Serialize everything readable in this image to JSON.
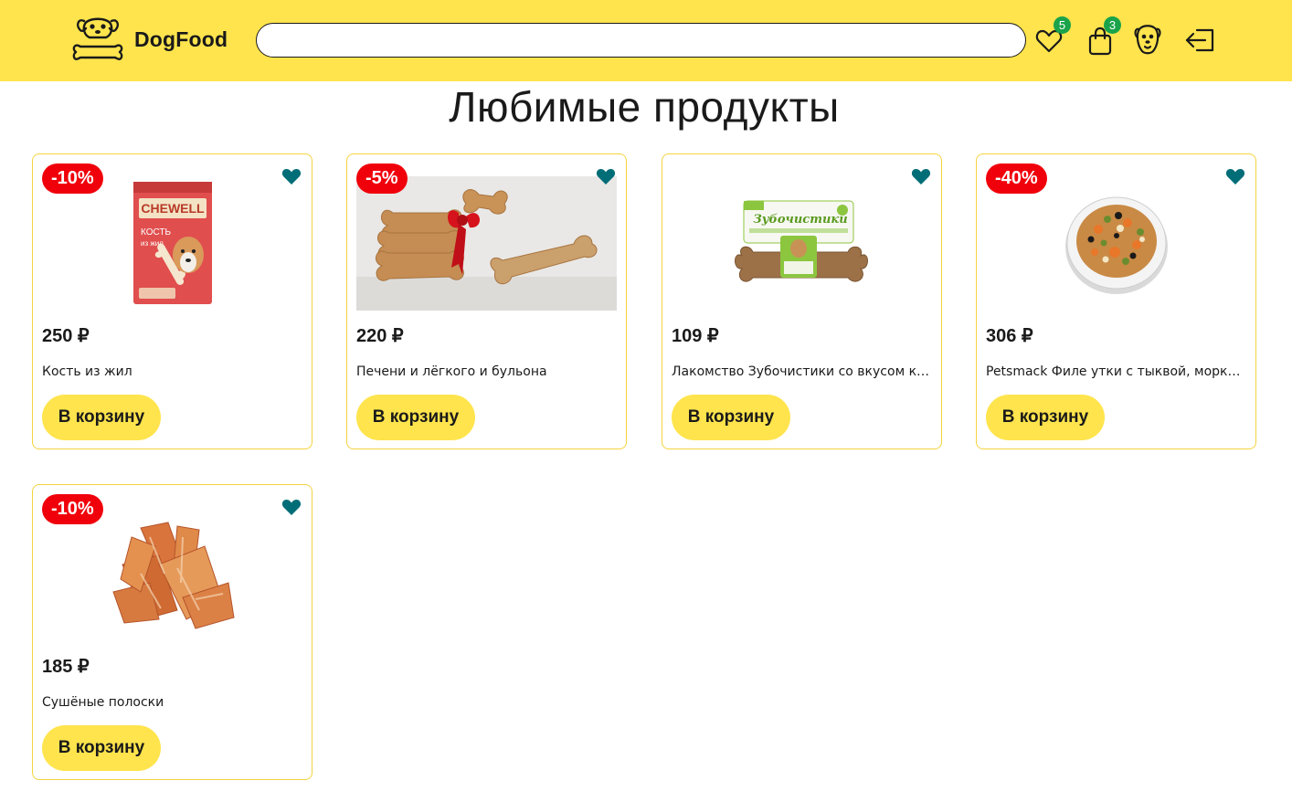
{
  "header": {
    "brand": "DogFood",
    "search_value": "",
    "favorites_count": "5",
    "cart_count": "3",
    "icons": [
      "dog-logo-icon",
      "heart-icon",
      "shopping-bag-icon",
      "dog-face-profile-icon",
      "logout-icon"
    ]
  },
  "page": {
    "title": "Любимые продукты"
  },
  "colors": {
    "header_bg": "#ffe44d",
    "discount_badge": "#f0000a",
    "favorite_heart": "#006d77",
    "count_badge": "#1aa34a",
    "card_border": "#f5d33f"
  },
  "products": [
    {
      "discount": "-10%",
      "price": "250 ₽",
      "name": "Кость из жил",
      "button": "В корзину",
      "image": "chewell-bone-package"
    },
    {
      "discount": "-5%",
      "price": "220 ₽",
      "name": "Печени и лёгкого и бульона",
      "button": "В корзину",
      "image": "bone-cookies-red-bow"
    },
    {
      "discount": "",
      "price": "109 ₽",
      "name": "Лакомство Зубочистики со вкусом курицы",
      "button": "В корзину",
      "image": "zubochistiki-chew-bone"
    },
    {
      "discount": "-40%",
      "price": "306 ₽",
      "name": "Petsmack Филе утки с тыквой, морковью",
      "button": "В корзину",
      "image": "duck-food-bowl"
    },
    {
      "discount": "-10%",
      "price": "185 ₽",
      "name": "Сушёные полоски",
      "button": "В корзину",
      "image": "dried-chicken-strips"
    }
  ]
}
